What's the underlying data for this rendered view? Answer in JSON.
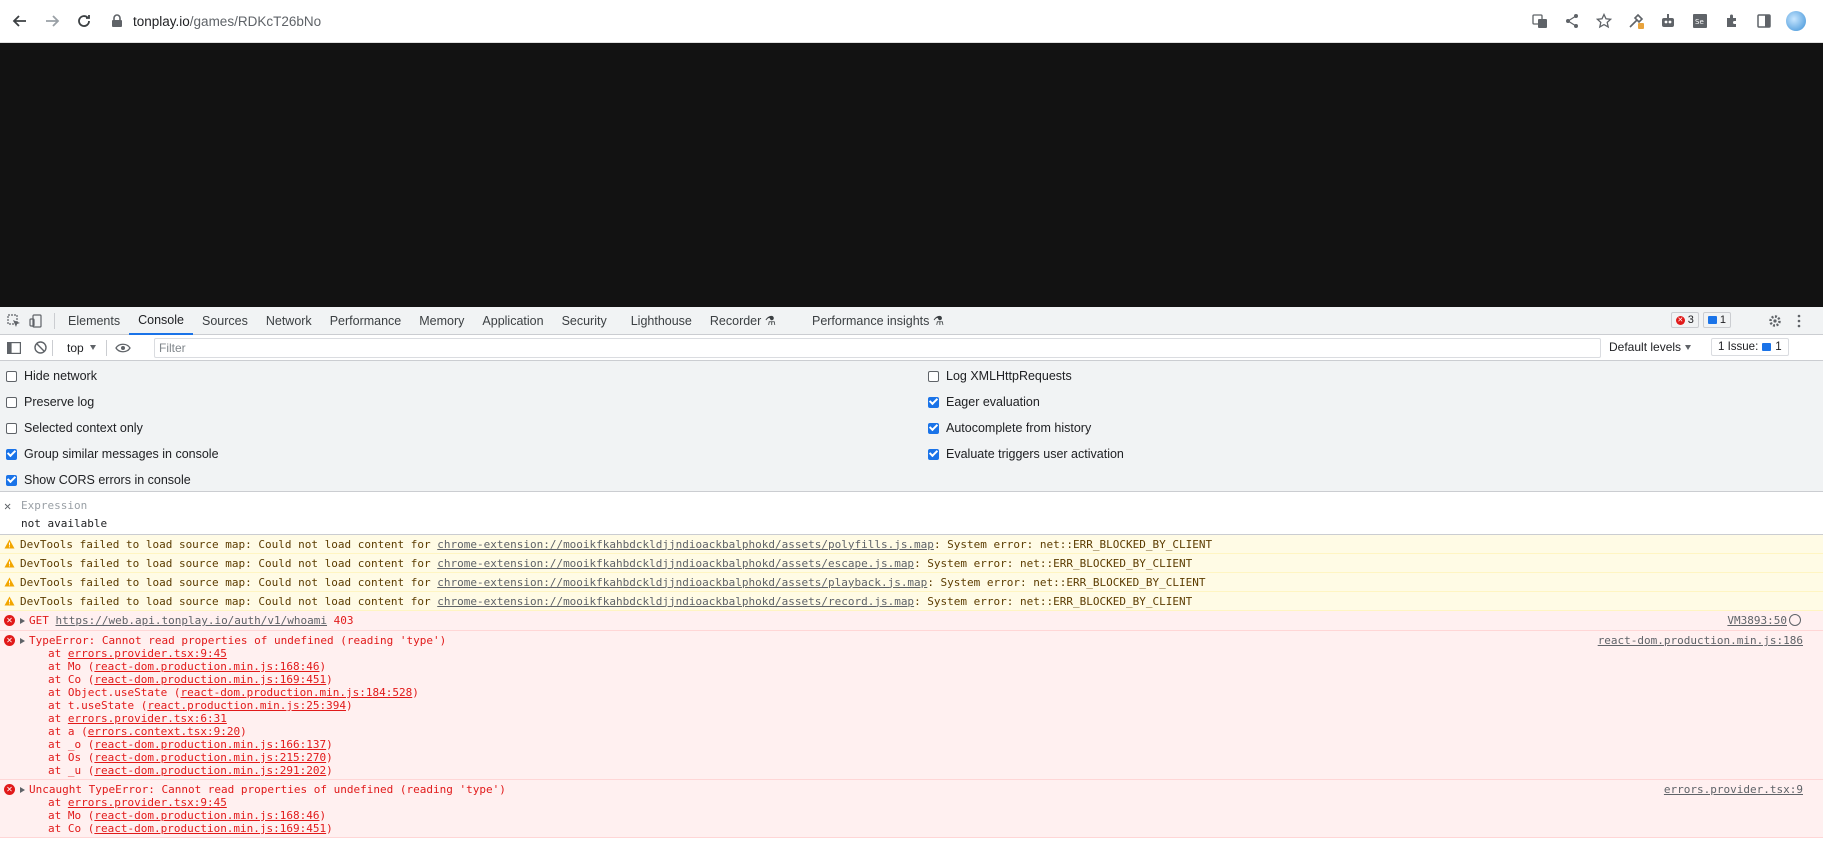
{
  "browser": {
    "url_host": "tonplay.io",
    "url_path": "/games/RDKcT26bNo"
  },
  "devtools": {
    "tabs": [
      "Elements",
      "Console",
      "Sources",
      "Network",
      "Performance",
      "Memory",
      "Application",
      "Security",
      "Lighthouse",
      "Recorder ⚗",
      "Performance insights ⚗"
    ],
    "active_tab": "Console",
    "error_count": "3",
    "message_count": "1",
    "colors": {
      "accent": "#1a73e8",
      "error": "#e11a1a",
      "warning_bg": "#fffbe5"
    }
  },
  "toolbar": {
    "context": "top",
    "filter_placeholder": "Filter",
    "levels": "Default levels",
    "issues_label": "1 Issue:",
    "issues_count": "1"
  },
  "settings": {
    "left": [
      {
        "label": "Hide network",
        "checked": false
      },
      {
        "label": "Preserve log",
        "checked": false
      },
      {
        "label": "Selected context only",
        "checked": false
      },
      {
        "label": "Group similar messages in console",
        "checked": true
      },
      {
        "label": "Show CORS errors in console",
        "checked": true
      }
    ],
    "right": [
      {
        "label": "Log XMLHttpRequests",
        "checked": false
      },
      {
        "label": "Eager evaluation",
        "checked": true
      },
      {
        "label": "Autocomplete from history",
        "checked": true
      },
      {
        "label": "Evaluate triggers user activation",
        "checked": true
      }
    ]
  },
  "expression": {
    "placeholder": "Expression",
    "value": "not available"
  },
  "warnings": [
    {
      "prefix": "DevTools failed to load source map: Could not load content for ",
      "link": "chrome-extension://mooikfkahbdckldjjndioackbalphokd/assets/polyfills.js.map",
      "suffix": ": System error: net::ERR_BLOCKED_BY_CLIENT"
    },
    {
      "prefix": "DevTools failed to load source map: Could not load content for ",
      "link": "chrome-extension://mooikfkahbdckldjjndioackbalphokd/assets/escape.js.map",
      "suffix": ": System error: net::ERR_BLOCKED_BY_CLIENT"
    },
    {
      "prefix": "DevTools failed to load source map: Could not load content for ",
      "link": "chrome-extension://mooikfkahbdckldjjndioackbalphokd/assets/playback.js.map",
      "suffix": ": System error: net::ERR_BLOCKED_BY_CLIENT"
    },
    {
      "prefix": "DevTools failed to load source map: Could not load content for ",
      "link": "chrome-extension://mooikfkahbdckldjjndioackbalphokd/assets/record.js.map",
      "suffix": ": System error: net::ERR_BLOCKED_BY_CLIENT"
    }
  ],
  "get_error": {
    "method": "GET",
    "url": "https://web.api.tonplay.io/auth/v1/whoami",
    "status": "403",
    "source": "VM3893:50"
  },
  "type_error": {
    "message": "TypeError: Cannot read properties of undefined (reading 'type')",
    "source": "react-dom.production.min.js:186",
    "stack": [
      {
        "pre": "at ",
        "link": "errors.provider.tsx:9:45",
        "post": ""
      },
      {
        "pre": "at Mo (",
        "link": "react-dom.production.min.js:168:46",
        "post": ")"
      },
      {
        "pre": "at Co (",
        "link": "react-dom.production.min.js:169:451",
        "post": ")"
      },
      {
        "pre": "at Object.useState (",
        "link": "react-dom.production.min.js:184:528",
        "post": ")"
      },
      {
        "pre": "at t.useState (",
        "link": "react.production.min.js:25:394",
        "post": ")"
      },
      {
        "pre": "at ",
        "link": "errors.provider.tsx:6:31",
        "post": ""
      },
      {
        "pre": "at a (",
        "link": "errors.context.tsx:9:20",
        "post": ")"
      },
      {
        "pre": "at _o (",
        "link": "react-dom.production.min.js:166:137",
        "post": ")"
      },
      {
        "pre": "at Os (",
        "link": "react-dom.production.min.js:215:270",
        "post": ")"
      },
      {
        "pre": "at _u (",
        "link": "react-dom.production.min.js:291:202",
        "post": ")"
      }
    ]
  },
  "uncaught_error": {
    "message": "Uncaught TypeError: Cannot read properties of undefined (reading 'type')",
    "source": "errors.provider.tsx:9",
    "stack": [
      {
        "pre": "at ",
        "link": "errors.provider.tsx:9:45",
        "post": ""
      },
      {
        "pre": "at Mo (",
        "link": "react-dom.production.min.js:168:46",
        "post": ")"
      },
      {
        "pre": "at Co (",
        "link": "react-dom.production.min.js:169:451",
        "post": ")"
      }
    ]
  }
}
